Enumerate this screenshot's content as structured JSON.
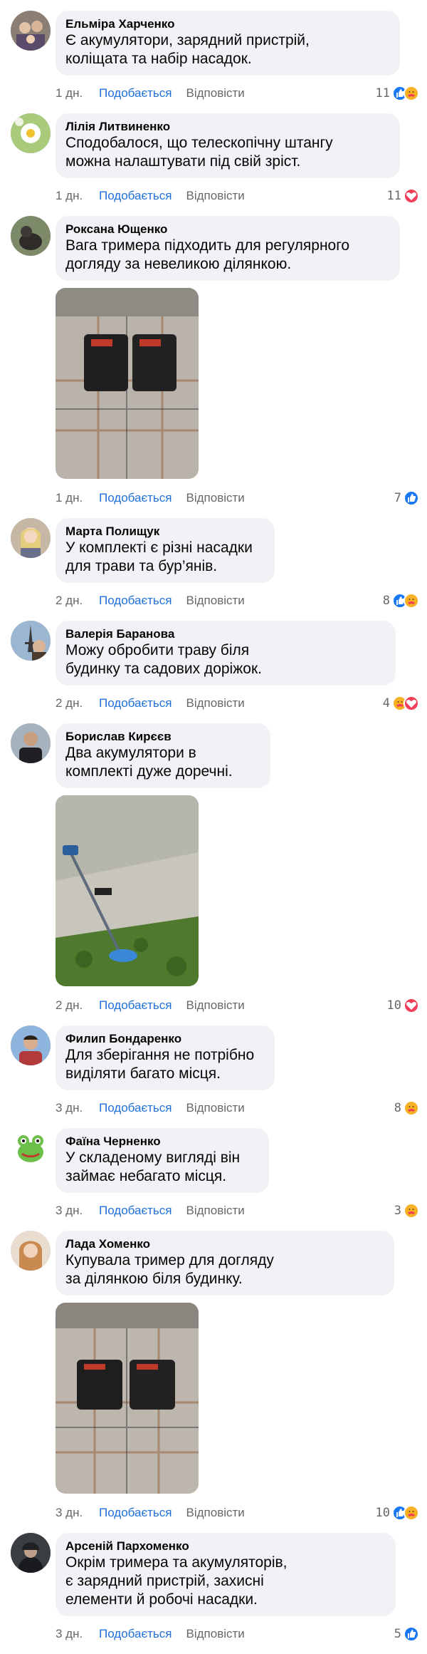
{
  "comments": [
    {
      "author": "Ельміра Харченко",
      "text": "Є акумулятори, зарядний пристрій,\nколіщата та набір насадок.",
      "time": "1 дн.",
      "like": "Подобається",
      "reply": "Відповісти",
      "count": "11",
      "reactions": [
        "like",
        "care"
      ],
      "avatar": "family-photo"
    },
    {
      "author": "Лілія Литвиненко",
      "text": "Сподобалося, що телескопічну штангу\nможна налаштувати під свій зріст.",
      "time": "1 дн.",
      "like": "Подобається",
      "reply": "Відповісти",
      "count": "11",
      "reactions": [
        "love"
      ],
      "avatar": "daisy-photo"
    },
    {
      "author": "Роксана Ющенко",
      "text": "Вага тримера підходить для регулярного\nдогляду за невеликою ділянкою.",
      "time": "1 дн.",
      "like": "Подобається",
      "reply": "Відповісти",
      "count": "7",
      "reactions": [
        "like"
      ],
      "avatar": "dog-photo",
      "photo": "batteries-on-plaid"
    },
    {
      "author": "Марта Полищук",
      "text": "У комплекті є різні насадки\nдля трави та бур’янів.",
      "time": "2 дн.",
      "like": "Подобається",
      "reply": "Відповісти",
      "count": "8",
      "reactions": [
        "like",
        "care"
      ],
      "avatar": "woman-blonde"
    },
    {
      "author": "Валерія Баранова",
      "text": "Можу обробити траву біля\nбудинку та садових доріжок.",
      "time": "2 дн.",
      "like": "Подобається",
      "reply": "Відповісти",
      "count": "4",
      "reactions": [
        "care",
        "love"
      ],
      "avatar": "eiffel-photo"
    },
    {
      "author": "Борислав Кирєєв",
      "text": "Два акумулятори в\nкомплекті дуже доречні.",
      "time": "2 дн.",
      "like": "Подобається",
      "reply": "Відповісти",
      "count": "10",
      "reactions": [
        "love"
      ],
      "avatar": "man-photo",
      "photo": "trimmer-on-grass"
    },
    {
      "author": "Филип Бондаренко",
      "text": "Для зберігання не потрібно\nвиділяти багато місця.",
      "time": "3 дн.",
      "like": "Подобається",
      "reply": "Відповісти",
      "count": "8",
      "reactions": [
        "care"
      ],
      "avatar": "man-sky"
    },
    {
      "author": "Фаїна Черненко",
      "text": "У складеному вигляді він\nзаймає небагато місця.",
      "time": "3 дн.",
      "like": "Подобається",
      "reply": "Відповісти",
      "count": "3",
      "reactions": [
        "care"
      ],
      "avatar": "frog-cartoon"
    },
    {
      "author": "Лада Хоменко",
      "text": "Купувала тример для догляду\nза ділянкою біля будинку.",
      "time": "3 дн.",
      "like": "Подобається",
      "reply": "Відповісти",
      "count": "10",
      "reactions": [
        "like",
        "care"
      ],
      "avatar": "woman-redhead",
      "photo": "batteries-on-plaid-2"
    },
    {
      "author": "Арсеній Пархоменко",
      "text": "Окрім тримера та акумуляторів,\nє зарядний пристрій, захисні\nелементи й робочі насадки.",
      "time": "3 дн.",
      "like": "Подобається",
      "reply": "Відповісти",
      "count": "5",
      "reactions": [
        "like"
      ],
      "avatar": "man-hood"
    }
  ],
  "colors": {
    "bubble": "#f0f2f5",
    "link": "#216fdb",
    "muted": "#65676b",
    "like": "#1877f2",
    "love": "#f33e58",
    "care": "#f7b125"
  }
}
